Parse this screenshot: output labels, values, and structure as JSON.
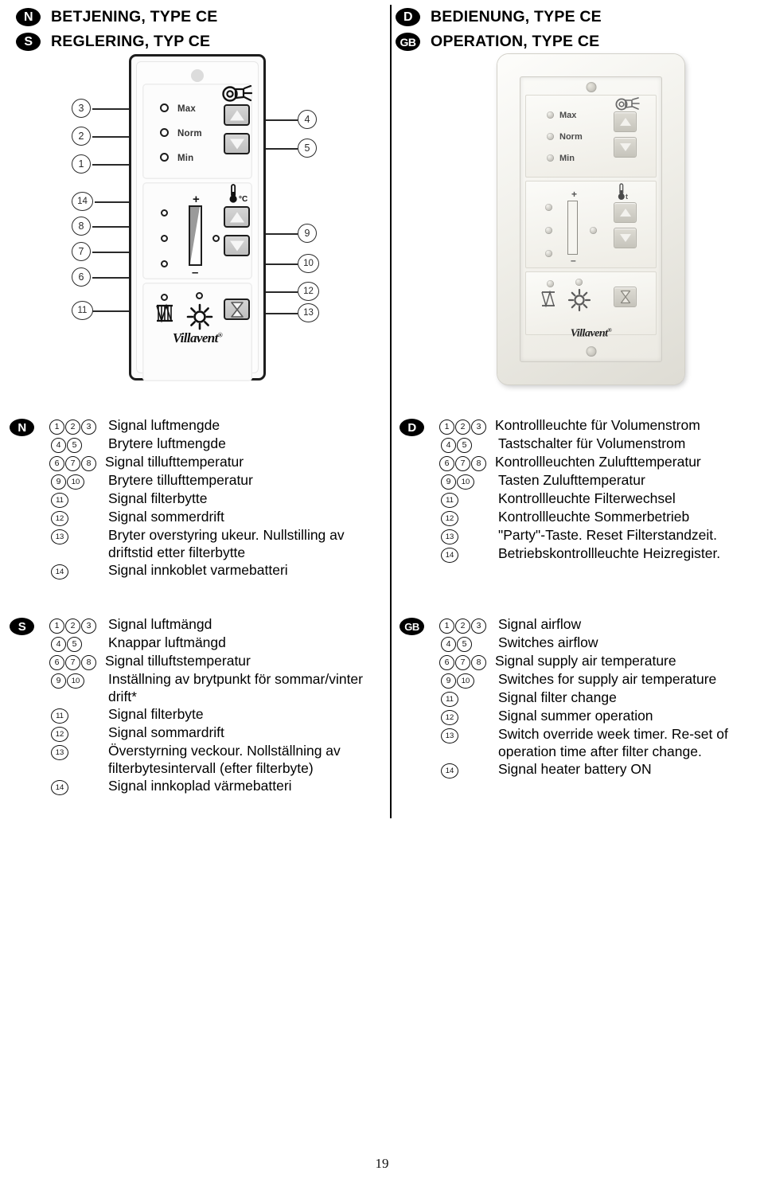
{
  "headers": {
    "left": [
      {
        "badge": "N",
        "title": "BETJENING, TYPE CE"
      },
      {
        "badge": "S",
        "title": "REGLERING, TYP CE"
      }
    ],
    "right": [
      {
        "badge": "D",
        "title": "BEDIENUNG, TYPE CE"
      },
      {
        "badge": "GB",
        "title": "OPERATION, TYPE CE"
      }
    ]
  },
  "diagram": {
    "led_labels": {
      "max": "Max",
      "norm": "Norm",
      "min": "Min"
    },
    "slider": {
      "plus": "+",
      "minus": "–"
    },
    "thermometer_unit": "°C",
    "brand": "Villavent",
    "brand_mark": "®",
    "callouts_left": [
      "3",
      "2",
      "1",
      "14",
      "8",
      "7",
      "6",
      "11"
    ],
    "callouts_right": [
      "4",
      "5",
      "9",
      "10",
      "12",
      "13"
    ],
    "icons": {
      "fan": "fan-icon",
      "thermometer": "thermometer-icon",
      "filter": "filter-icon",
      "sun": "sun-icon",
      "hourglass": "hourglass-icon"
    }
  },
  "photo": {
    "led_labels": {
      "max": "Max",
      "norm": "Norm",
      "min": "Min"
    },
    "slider": {
      "plus": "+",
      "minus": "–"
    },
    "thermometer_unit": "t",
    "brand": "Villavent",
    "brand_mark": "®"
  },
  "legends": {
    "no": {
      "badge": "N",
      "rows": [
        {
          "nums": [
            "1",
            "2",
            "3"
          ],
          "text": "Signal luftmengde"
        },
        {
          "nums": [
            "4",
            "5"
          ],
          "text": "Brytere luftmengde"
        },
        {
          "nums": [
            "6",
            "7",
            "8"
          ],
          "text": "Signal tillufttemperatur"
        },
        {
          "nums": [
            "9",
            "10"
          ],
          "text": "Brytere tillufttemperatur"
        },
        {
          "nums": [
            "11"
          ],
          "text": "Signal filterbytte"
        },
        {
          "nums": [
            "12"
          ],
          "text": "Signal sommerdrift"
        },
        {
          "nums": [
            "13"
          ],
          "text": "Bryter overstyring ukeur. Nullstilling av driftstid etter filterbytte"
        },
        {
          "nums": [
            "14"
          ],
          "text": "Signal innkoblet varmebatteri"
        }
      ]
    },
    "se": {
      "badge": "S",
      "rows": [
        {
          "nums": [
            "1",
            "2",
            "3"
          ],
          "text": "Signal luftmängd"
        },
        {
          "nums": [
            "4",
            "5"
          ],
          "text": "Knappar luftmängd"
        },
        {
          "nums": [
            "6",
            "7",
            "8"
          ],
          "text": "Signal tilluftstemperatur"
        },
        {
          "nums": [
            "9",
            "10"
          ],
          "text": "Inställning av brytpunkt för sommar/vinter drift*"
        },
        {
          "nums": [
            "11"
          ],
          "text": "Signal filterbyte"
        },
        {
          "nums": [
            "12"
          ],
          "text": "Signal sommardrift"
        },
        {
          "nums": [
            "13"
          ],
          "text": "Överstyrning veckour. Nollställning av filterbytesintervall (efter filterbyte)"
        },
        {
          "nums": [
            "14"
          ],
          "text": "Signal innkoplad värmebatteri"
        }
      ]
    },
    "de": {
      "badge": "D",
      "rows": [
        {
          "nums": [
            "1",
            "2",
            "3"
          ],
          "text": "Kontrollleuchte für Volumenstrom"
        },
        {
          "nums": [
            "4",
            "5"
          ],
          "text": "Tastschalter für Volumenstrom"
        },
        {
          "nums": [
            "6",
            "7",
            "8"
          ],
          "text": "Kontrollleuchten Zulufttemperatur"
        },
        {
          "nums": [
            "9",
            "10"
          ],
          "text": "Tasten Zulufttemperatur"
        },
        {
          "nums": [
            "11"
          ],
          "text": "Kontrollleuchte Filterwechsel"
        },
        {
          "nums": [
            "12"
          ],
          "text": "Kontrollleuchte Sommerbetrieb"
        },
        {
          "nums": [
            "13"
          ],
          "text": "\"Party\"-Taste. Reset Filterstandzeit."
        },
        {
          "nums": [
            "14"
          ],
          "text": "Betriebskontrollleuchte Heizregister."
        }
      ]
    },
    "gb": {
      "badge": "GB",
      "rows": [
        {
          "nums": [
            "1",
            "2",
            "3"
          ],
          "text": "Signal airflow"
        },
        {
          "nums": [
            "4",
            "5"
          ],
          "text": "Switches airflow"
        },
        {
          "nums": [
            "6",
            "7",
            "8"
          ],
          "text": "Signal supply air temperature"
        },
        {
          "nums": [
            "9",
            "10"
          ],
          "text": "Switches for supply air temperature"
        },
        {
          "nums": [
            "11"
          ],
          "text": "Signal filter change"
        },
        {
          "nums": [
            "12"
          ],
          "text": "Signal summer operation"
        },
        {
          "nums": [
            "13"
          ],
          "text": "Switch override week timer. Re-set of operation time after filter change."
        },
        {
          "nums": [
            "14"
          ],
          "text": "Signal heater battery ON"
        }
      ]
    }
  },
  "page_number": "19"
}
